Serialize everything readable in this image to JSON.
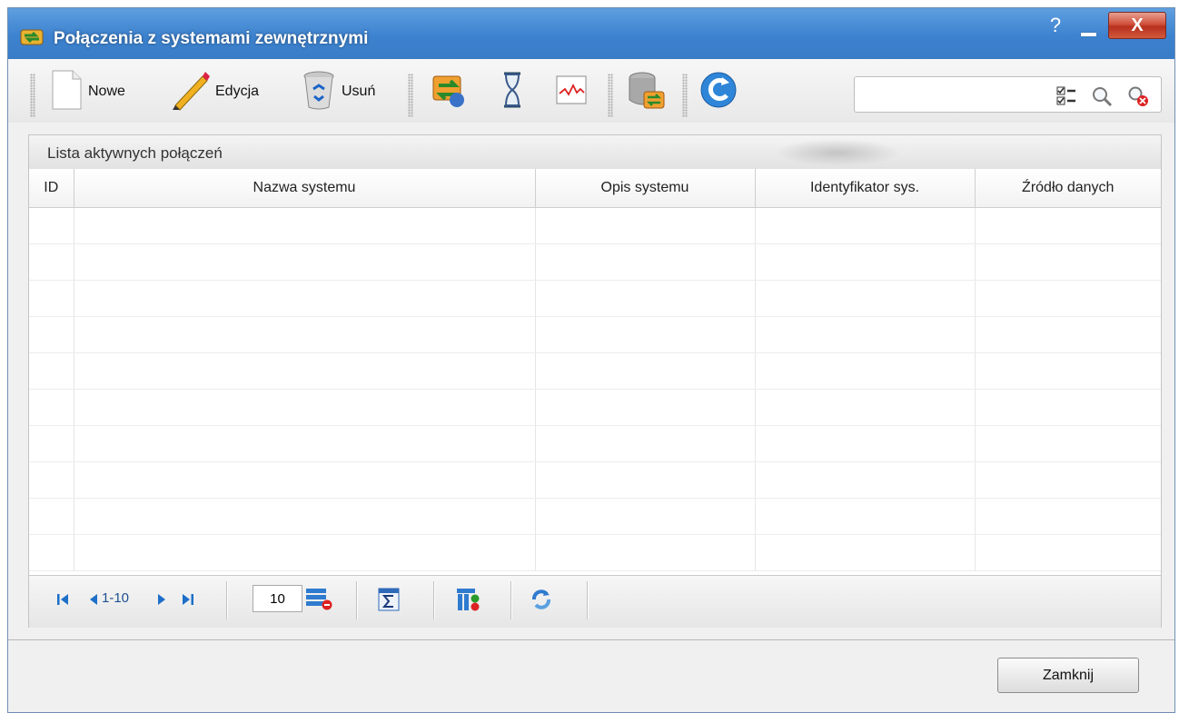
{
  "window": {
    "title": "Połączenia z systemami zewnętrznymi",
    "help_label": "?",
    "close_label": "X"
  },
  "toolbar": {
    "new_label": "Nowe",
    "edit_label": "Edycja",
    "delete_label": "Usuń",
    "icons": [
      "new-document-icon",
      "pencil-icon",
      "recycle-bin-icon",
      "transfer-icon",
      "hourglass-icon",
      "chart-icon",
      "database-icon",
      "refresh-icon"
    ]
  },
  "search": {
    "value": "",
    "placeholder": "",
    "icons": [
      "checklist-icon",
      "magnifier-icon",
      "clear-search-icon"
    ]
  },
  "panel": {
    "title": "Lista aktywnych połączeń",
    "columns": [
      "ID",
      "Nazwa systemu",
      "Opis systemu",
      "Identyfikator sys.",
      "Źródło danych"
    ],
    "rows": []
  },
  "pager": {
    "range": "1-10",
    "page_size": "10"
  },
  "footer": {
    "close_label": "Zamknij"
  },
  "colors": {
    "titlebar": "#3d82cf",
    "close_button": "#c8432e",
    "pager_text": "#1d4f91"
  }
}
